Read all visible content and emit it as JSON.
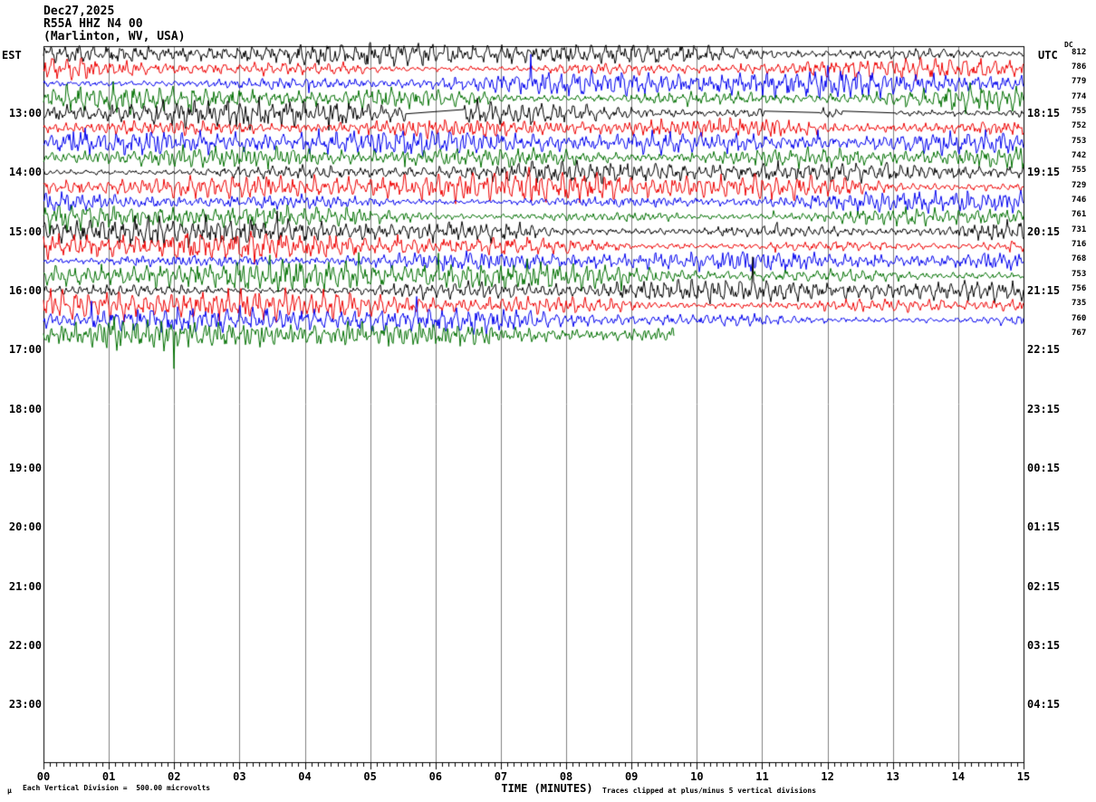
{
  "header": {
    "date": "Dec27,2025",
    "station": "R55A HHZ N4 00",
    "location": "(Marlinton, WV, USA)"
  },
  "left_axis": {
    "label": "EST",
    "ticks": [
      "13:00",
      "14:00",
      "15:00",
      "16:00",
      "17:00",
      "18:00",
      "19:00",
      "20:00",
      "21:00",
      "22:00",
      "23:00"
    ]
  },
  "right_axis": {
    "label": "UTC",
    "ticks": [
      "18:15",
      "19:15",
      "20:15",
      "21:15",
      "22:15",
      "23:15",
      "00:15",
      "01:15",
      "02:15",
      "03:15",
      "04:15"
    ]
  },
  "dc_column": {
    "header": "DC",
    "values": [
      "812",
      "786",
      "779",
      "774",
      "755",
      "752",
      "753",
      "742",
      "755",
      "729",
      "746",
      "761",
      "731",
      "716",
      "768",
      "753",
      "756",
      "735",
      "760",
      "767"
    ]
  },
  "x_axis": {
    "title": "TIME (MINUTES)",
    "tick_labels": [
      "00",
      "01",
      "02",
      "03",
      "04",
      "05",
      "06",
      "07",
      "08",
      "09",
      "10",
      "11",
      "12",
      "13",
      "14",
      "15"
    ]
  },
  "footer": {
    "mu_mark": "µ",
    "scale_note": "Each Vertical Division =  500.00 microvolts",
    "clip_note": "Traces clipped at plus/minus 5 vertical divisions"
  },
  "chart_data": {
    "type": "line",
    "title": "Helicorder seismogram R55A HHZ N4 00, Dec27,2025",
    "xlabel": "TIME (MINUTES)",
    "x_range_minutes": [
      0,
      15
    ],
    "minutes_per_row": 15,
    "clip_divisions": 5,
    "grid": true,
    "grid_color": "#808080",
    "colors": {
      "black": "#000000",
      "red": "#ee0000",
      "blue": "#0000ee",
      "green": "#007000"
    },
    "rows": [
      {
        "est_start": "12:00",
        "color": "black",
        "dc": 812
      },
      {
        "est_start": "12:15",
        "color": "red",
        "dc": 786
      },
      {
        "est_start": "12:30",
        "color": "blue",
        "dc": 779
      },
      {
        "est_start": "12:45",
        "color": "green",
        "dc": 774
      },
      {
        "est_start": "13:00",
        "color": "black",
        "dc": 755
      },
      {
        "est_start": "13:15",
        "color": "red",
        "dc": 752
      },
      {
        "est_start": "13:30",
        "color": "blue",
        "dc": 753
      },
      {
        "est_start": "13:45",
        "color": "green",
        "dc": 742
      },
      {
        "est_start": "14:00",
        "color": "black",
        "dc": 755
      },
      {
        "est_start": "14:15",
        "color": "red",
        "dc": 729
      },
      {
        "est_start": "14:30",
        "color": "blue",
        "dc": 746
      },
      {
        "est_start": "14:45",
        "color": "green",
        "dc": 761
      },
      {
        "est_start": "15:00",
        "color": "black",
        "dc": 731
      },
      {
        "est_start": "15:15",
        "color": "red",
        "dc": 716
      },
      {
        "est_start": "15:30",
        "color": "blue",
        "dc": 768
      },
      {
        "est_start": "15:45",
        "color": "green",
        "dc": 753
      },
      {
        "est_start": "16:00",
        "color": "black",
        "dc": 756
      },
      {
        "est_start": "16:15",
        "color": "red",
        "dc": 735
      },
      {
        "est_start": "16:30",
        "color": "blue",
        "dc": 760
      },
      {
        "est_start": "16:45",
        "color": "green",
        "dc": 767,
        "end_min": 9.66
      }
    ],
    "gaps": [
      {
        "row": 4,
        "from_min": 5.55,
        "to_min": 6.43
      },
      {
        "row": 4,
        "from_min": 11.05,
        "to_min": 11.88
      },
      {
        "row": 4,
        "from_min": 12.23,
        "to_min": 13.03
      }
    ]
  }
}
